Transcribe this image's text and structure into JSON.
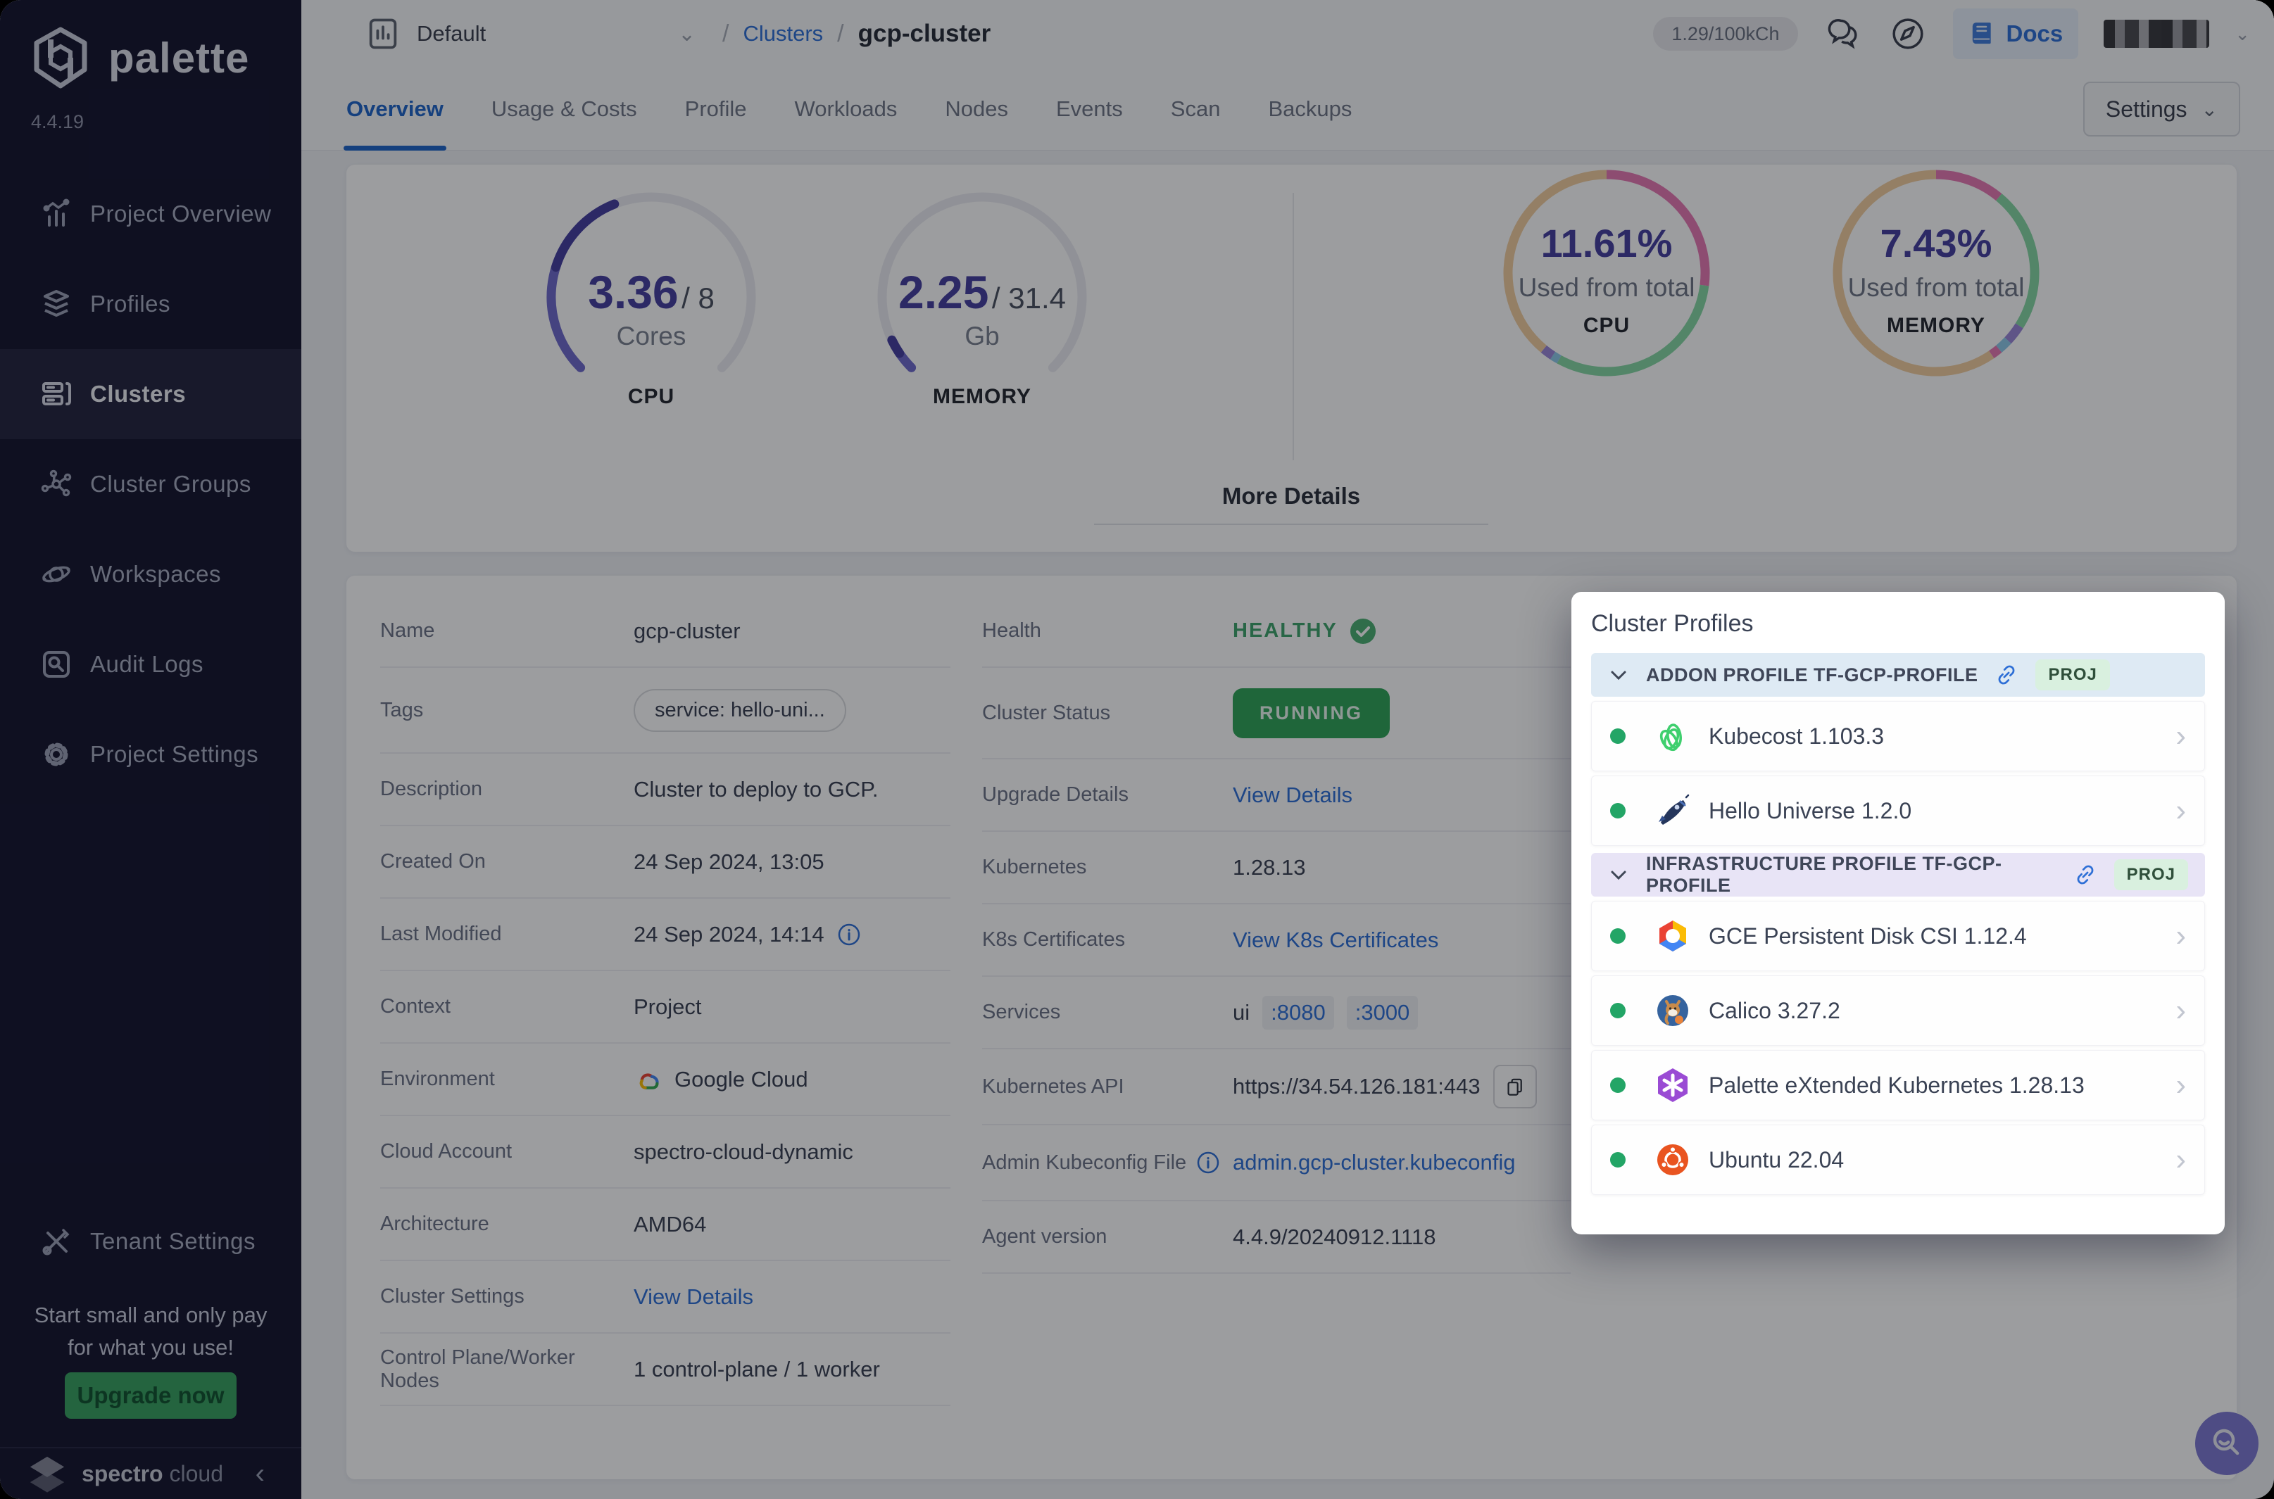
{
  "colors": {
    "accent_blue": "#2E6FD6",
    "indigo_value": "#453F9E",
    "gauge_light": "#6F6ACC",
    "gauge_dark": "#453F9E",
    "gauge_track": "#ECECF2",
    "running_green": "#2FA457",
    "healthy_green": "#3FA36B",
    "status_dot_green": "#23A566",
    "fab_indigo": "#7D78D2"
  },
  "sidebar": {
    "logo_text": "palette",
    "version": "4.4.19",
    "items": [
      {
        "label": "Project Overview"
      },
      {
        "label": "Profiles"
      },
      {
        "label": "Clusters"
      },
      {
        "label": "Cluster Groups"
      },
      {
        "label": "Workspaces"
      },
      {
        "label": "Audit Logs"
      },
      {
        "label": "Project Settings"
      }
    ],
    "tenant_settings_label": "Tenant Settings",
    "promo_line1": "Start small and only pay",
    "promo_line2": "for what you use!",
    "upgrade_button": "Upgrade now",
    "brand_primary": "spectro",
    "brand_secondary": "cloud"
  },
  "topbar": {
    "project_selector": "Default",
    "breadcrumb_sep1": "/",
    "breadcrumb_link": "Clusters",
    "breadcrumb_sep2": "/",
    "breadcrumb_current": "gcp-cluster",
    "usage_pill": "1.29/100kCh",
    "docs_label": "Docs"
  },
  "tabs": {
    "items": [
      {
        "label": "Overview"
      },
      {
        "label": "Usage & Costs"
      },
      {
        "label": "Profile"
      },
      {
        "label": "Workloads"
      },
      {
        "label": "Nodes"
      },
      {
        "label": "Events"
      },
      {
        "label": "Scan"
      },
      {
        "label": "Backups"
      }
    ],
    "settings_button": "Settings"
  },
  "gauges": {
    "cpu": {
      "value": "3.36",
      "total": "/ 8",
      "unit": "Cores",
      "label": "CPU",
      "percent": 42
    },
    "memory": {
      "value": "2.25",
      "total": "/ 31.4",
      "unit": "Gb",
      "label": "MEMORY",
      "percent": 7.2
    },
    "cpu_usage": {
      "value": "11.61%",
      "caption": "Used from total",
      "label": "CPU",
      "segments": [
        {
          "color": "#E678B2",
          "pct": 27
        },
        {
          "color": "#85D8A4",
          "pct": 31
        },
        {
          "color": "#8CC8E8",
          "pct": 1.2
        },
        {
          "color": "#9A86D8",
          "pct": 1.8
        },
        {
          "color": "#F2CD9E",
          "pct": 39
        }
      ]
    },
    "memory_usage": {
      "value": "7.43%",
      "caption": "Used from total",
      "label": "MEMORY",
      "segments": [
        {
          "color": "#E678B2",
          "pct": 11
        },
        {
          "color": "#85D8A4",
          "pct": 23
        },
        {
          "color": "#9A86D8",
          "pct": 3
        },
        {
          "color": "#8CC8E8",
          "pct": 2
        },
        {
          "color": "#E678B2",
          "pct": 1.5
        },
        {
          "color": "#F2CD9E",
          "pct": 59.5
        }
      ]
    },
    "more_details": "More Details"
  },
  "details": {
    "left": [
      {
        "label": "Name",
        "value": "gcp-cluster"
      },
      {
        "label": "Tags",
        "value": "service: hello-uni..."
      },
      {
        "label": "Description",
        "value": "Cluster to deploy to GCP."
      },
      {
        "label": "Created On",
        "value": "24 Sep 2024, 13:05"
      },
      {
        "label": "Last Modified",
        "value": "24 Sep 2024, 14:14"
      },
      {
        "label": "Context",
        "value": "Project"
      },
      {
        "label": "Environment",
        "value": "Google Cloud"
      },
      {
        "label": "Cloud Account",
        "value": "spectro-cloud-dynamic"
      },
      {
        "label": "Architecture",
        "value": "AMD64"
      },
      {
        "label": "Cluster Settings",
        "value": "View Details"
      },
      {
        "label": "Control Plane/Worker Nodes",
        "value": "1 control-plane / 1 worker"
      }
    ],
    "right": [
      {
        "label": "Health",
        "value": "HEALTHY"
      },
      {
        "label": "Cluster Status",
        "value": "RUNNING"
      },
      {
        "label": "Upgrade Details",
        "value": "View Details"
      },
      {
        "label": "Kubernetes",
        "value": "1.28.13"
      },
      {
        "label": "K8s Certificates",
        "value": "View K8s Certificates"
      },
      {
        "label": "Services",
        "value": "ui",
        "ports": [
          ":8080",
          ":3000"
        ]
      },
      {
        "label": "Kubernetes API",
        "value": "https://34.54.126.181:443"
      },
      {
        "label": "Admin Kubeconfig File",
        "value": "admin.gcp-cluster.kubeconfig"
      },
      {
        "label": "Agent version",
        "value": "4.4.9/20240912.1118"
      }
    ]
  },
  "cluster_profiles": {
    "title": "Cluster Profiles",
    "groups": [
      {
        "name": "ADDON PROFILE TF-GCP-PROFILE",
        "badge": "PROJ",
        "items": [
          {
            "name": "Kubecost 1.103.3"
          },
          {
            "name": "Hello Universe 1.2.0"
          }
        ]
      },
      {
        "name": "INFRASTRUCTURE PROFILE TF-GCP-PROFILE",
        "badge": "PROJ",
        "items": [
          {
            "name": "GCE Persistent Disk CSI 1.12.4"
          },
          {
            "name": "Calico 3.27.2"
          },
          {
            "name": "Palette eXtended Kubernetes 1.28.13"
          },
          {
            "name": "Ubuntu 22.04"
          }
        ]
      }
    ]
  }
}
